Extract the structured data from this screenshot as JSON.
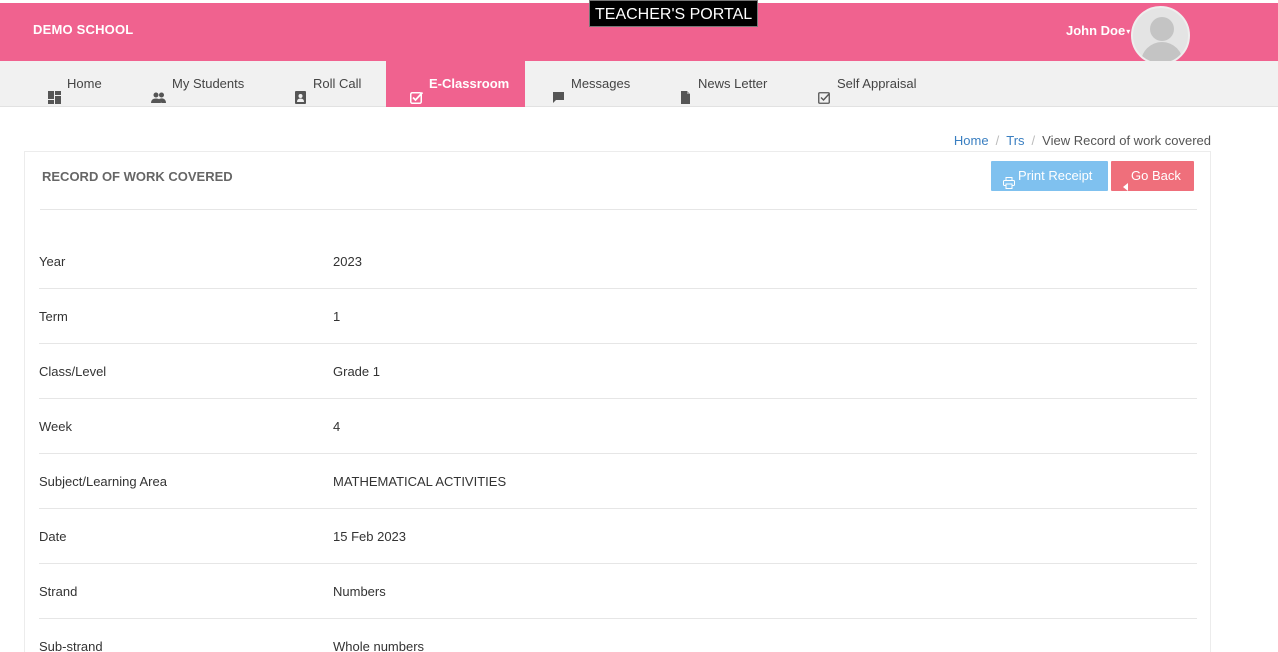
{
  "header": {
    "school_name": "DEMO SCHOOL",
    "portal_title": "TEACHER'S PORTAL",
    "user_name": "John Doe",
    "user_caret": "▾"
  },
  "nav": {
    "items": [
      {
        "label": "Home",
        "icon": "dashboard-icon"
      },
      {
        "label": "My Students",
        "icon": "people-icon"
      },
      {
        "label": "Roll Call",
        "icon": "contact-card-icon"
      },
      {
        "label": "E-Classroom",
        "icon": "checkbox-icon",
        "active": true
      },
      {
        "label": "Messages",
        "icon": "chat-bubble-icon"
      },
      {
        "label": "News Letter",
        "icon": "document-icon"
      },
      {
        "label": "Self Appraisal",
        "icon": "checkbox-outline-icon"
      }
    ]
  },
  "breadcrumb": {
    "home": "Home",
    "trs": "Trs",
    "current": "View Record of work covered",
    "sep": "/"
  },
  "panel": {
    "title": "RECORD OF WORK COVERED",
    "print_label": "Print Receipt",
    "back_label": "Go Back"
  },
  "record": [
    {
      "label": "Year",
      "value": "2023"
    },
    {
      "label": "Term",
      "value": "1"
    },
    {
      "label": "Class/Level",
      "value": "Grade 1"
    },
    {
      "label": "Week",
      "value": "4"
    },
    {
      "label": "Subject/Learning Area",
      "value": "MATHEMATICAL ACTIVITIES"
    },
    {
      "label": "Date",
      "value": "15 Feb 2023"
    },
    {
      "label": "Strand",
      "value": "Numbers"
    },
    {
      "label": "Sub-strand",
      "value": "Whole numbers"
    }
  ],
  "colors": {
    "brand_pink": "#f0628f",
    "print_button": "#7fc1ef",
    "back_button": "#ef6f7b",
    "link_blue": "#3a7fc1"
  }
}
